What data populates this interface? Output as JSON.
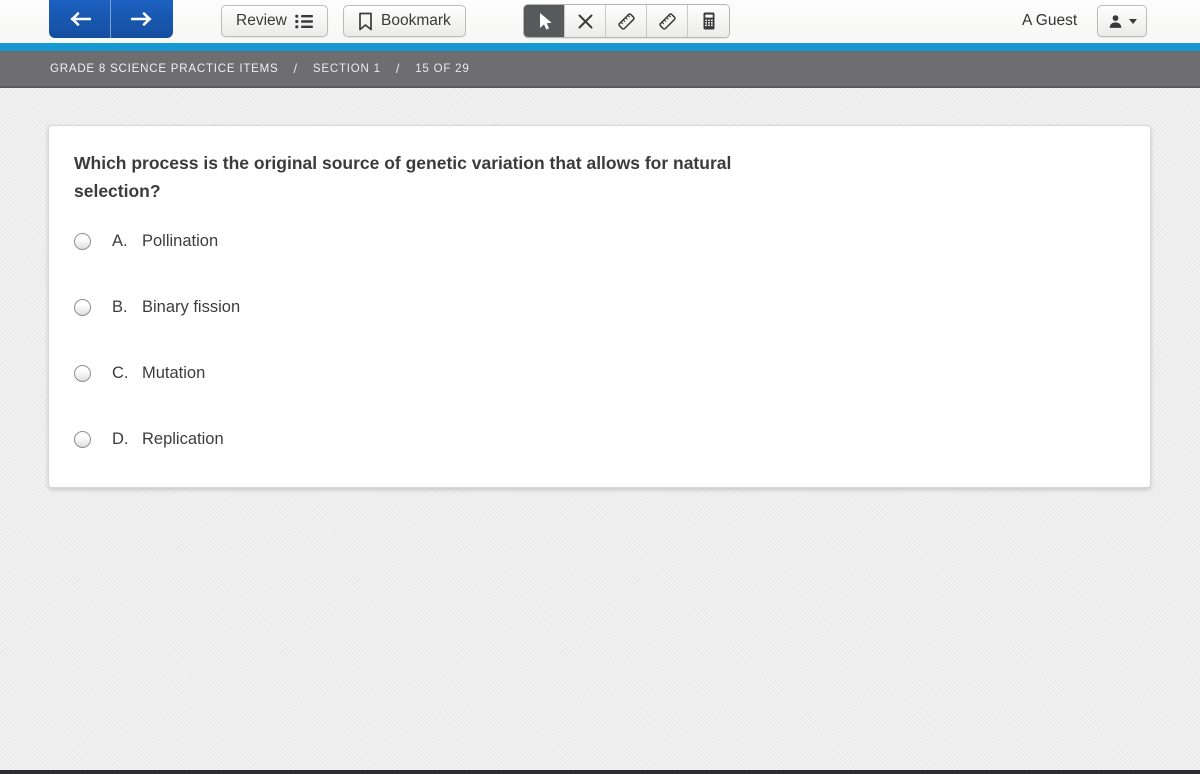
{
  "toolbar": {
    "back_tooltip": "previous",
    "forward_tooltip": "next",
    "review_label": "Review",
    "bookmark_label": "Bookmark",
    "tools": [
      {
        "name": "pointer",
        "icon": "cursor-icon",
        "selected": true
      },
      {
        "name": "answer-eliminator",
        "icon": "x-icon",
        "selected": false
      },
      {
        "name": "ruler",
        "icon": "ruler-icon",
        "selected": false
      },
      {
        "name": "ruler-secondary",
        "icon": "ruler-icon",
        "selected": false
      },
      {
        "name": "calculator",
        "icon": "calculator-icon",
        "selected": false
      }
    ],
    "user_label": "A Guest",
    "user_menu_icon": "person-icon"
  },
  "breadcrumb": {
    "test_name": "GRADE 8 SCIENCE PRACTICE ITEMS",
    "separator": "/",
    "section": "SECTION 1",
    "progress": "15 OF 29"
  },
  "question": {
    "text": "Which process is the original source of genetic variation that allows for natural selection?",
    "options": [
      {
        "letter": "A.",
        "text": "Pollination",
        "selected": false
      },
      {
        "letter": "B.",
        "text": "Binary fission",
        "selected": false
      },
      {
        "letter": "C.",
        "text": "Mutation",
        "selected": false
      },
      {
        "letter": "D.",
        "text": "Replication",
        "selected": false
      }
    ]
  },
  "colors": {
    "nav_button_blue": "#1a58b0",
    "accent_strip_cyan": "#1699d3",
    "breadcrumb_gray": "#6e6e70",
    "selected_tool_gray": "#58595b",
    "card_white": "#ffffff",
    "text_dark": "#3b3b3b"
  }
}
